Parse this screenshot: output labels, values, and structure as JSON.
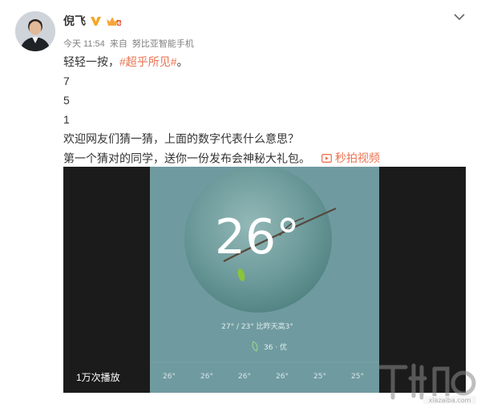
{
  "user": {
    "name": "倪飞",
    "avatar_icon": "user-avatar"
  },
  "meta": {
    "time": "今天 11:54",
    "source_prefix": "来自",
    "source": "努比亚智能手机"
  },
  "post": {
    "line1_pre": "轻轻一按，",
    "topic": "#超乎所见#",
    "line1_post": "。",
    "n1": "7",
    "n2": "5",
    "n3": "1",
    "line5": "欢迎网友们猜一猜，上面的数字代表什么意思？",
    "line6": "第一个猜对的同学，送你一份发布会神秘大礼包。",
    "video_link": "秒拍视频"
  },
  "video": {
    "temperature": "26°",
    "range": "27° / 23°  比昨天高3°",
    "aqi": "36 · 优",
    "forecast": [
      "26°",
      "26°",
      "26°",
      "26°",
      "25°",
      "25°"
    ],
    "play_count": "1万次播放"
  },
  "colors": {
    "accent": "#eb7350",
    "text": "#333333",
    "meta": "#808080",
    "verified": "#f5a623"
  }
}
